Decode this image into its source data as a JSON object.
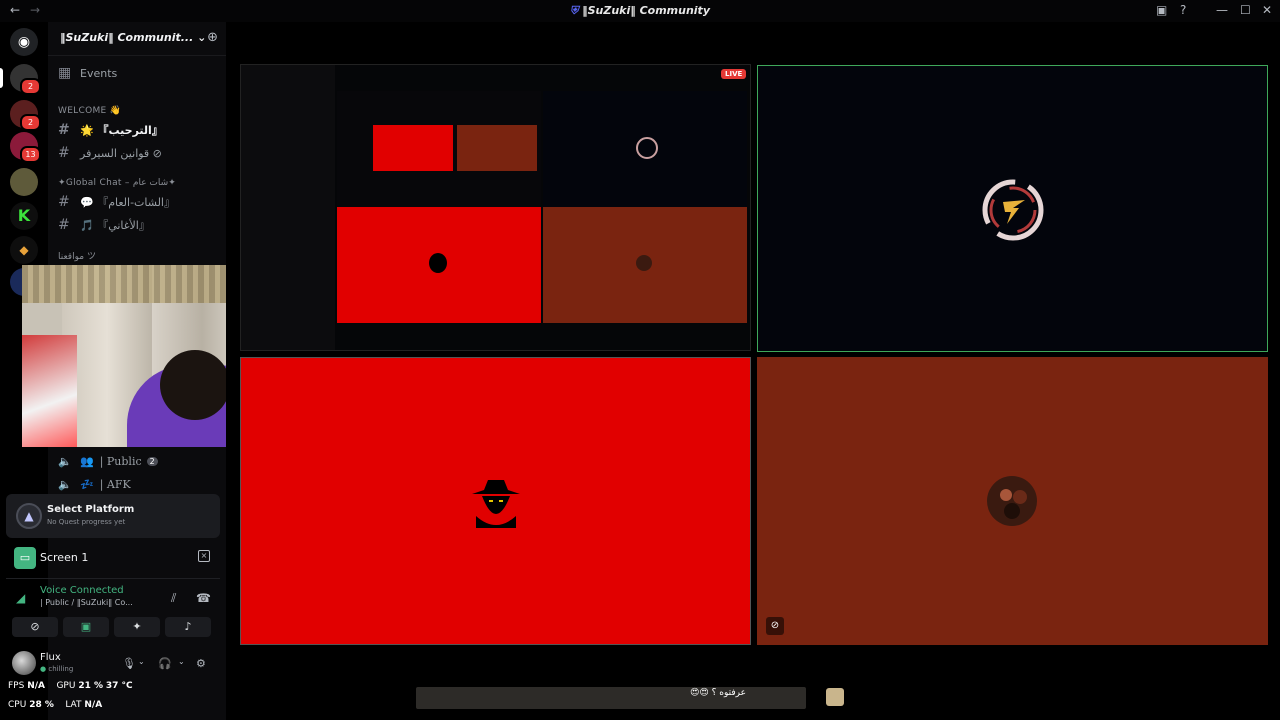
{
  "window": {
    "title": "‖SuZuki‖ Community",
    "back": "←",
    "forward": "→"
  },
  "rail": {
    "badges": [
      "2",
      "2",
      "13"
    ]
  },
  "server": {
    "name": "‖SuZuki‖ Communit...",
    "chevron": "⌄"
  },
  "channels": {
    "events_label": "Events",
    "welcome_category": "WELCOME 👋",
    "welcome_channel": "🌟 『الترحيب』",
    "rules_channel": "قوانين السيرفر ⊘",
    "global_category": "✦Global Chat – شات عام✦",
    "chat_channel": "💬 『الشات-العام』",
    "songs_channel": "🎵 『الأغاني』",
    "voice_category": "مواقعنا ツ",
    "public_voice": "| Public",
    "public_count": "2",
    "afk_voice": "| AFK"
  },
  "quest": {
    "title": "Select Platform",
    "subtitle": "No Quest progress yet"
  },
  "stream": {
    "label": "Screen 1"
  },
  "voice": {
    "status": "Voice Connected",
    "channel": "| Public / ‖SuZuki‖ Co..."
  },
  "user": {
    "name": "Flux",
    "status": "chilling"
  },
  "stats": {
    "fps_label": "FPS",
    "fps_value": "N/A",
    "gpu_label": "GPU",
    "gpu_value": "21 %",
    "gpu_temp": "37 °C",
    "cpu_label": "CPU",
    "cpu_value": "28 %",
    "lat_label": "LAT",
    "lat_value": "N/A"
  },
  "stage": {
    "live_badge": "LIVE",
    "bottom_caption": "عرفتوه ؟"
  },
  "icons": {
    "events": "calendar-icon",
    "hash": "hash-icon",
    "speaker": "speaker-icon",
    "add_member": "add-member-icon",
    "settings": "gear-icon"
  },
  "colors": {
    "voice_green": "#43b581",
    "live_red": "#e53935",
    "tile_red": "#e10000",
    "tile_brown": "#7a2410",
    "speaking_border": "#3fa85a"
  }
}
